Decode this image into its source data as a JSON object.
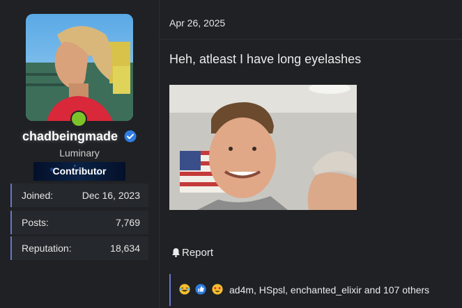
{
  "user": {
    "username": "chadbeingmade",
    "title": "Luminary",
    "banner": "Contributor",
    "stats": [
      {
        "label": "Joined:",
        "value": "Dec 16, 2023"
      },
      {
        "label": "Posts:",
        "value": "7,769"
      },
      {
        "label": "Reputation:",
        "value": "18,634"
      }
    ]
  },
  "post": {
    "date": "Apr 26, 2025",
    "text": "Heh, atleast I have long eyelashes",
    "report_label": "Report",
    "reactions_text": "ad4m, HSpsl, enchanted_elixir and 107 others",
    "reaction_icons": [
      "laughing-crying-emoji-icon",
      "thumbs-up-icon",
      "star-eyes-emoji-icon"
    ]
  },
  "colors": {
    "background": "#1f2124",
    "accent_border": "#6b77c8",
    "online": "#7cc32a",
    "verified": "#2f7de1"
  }
}
